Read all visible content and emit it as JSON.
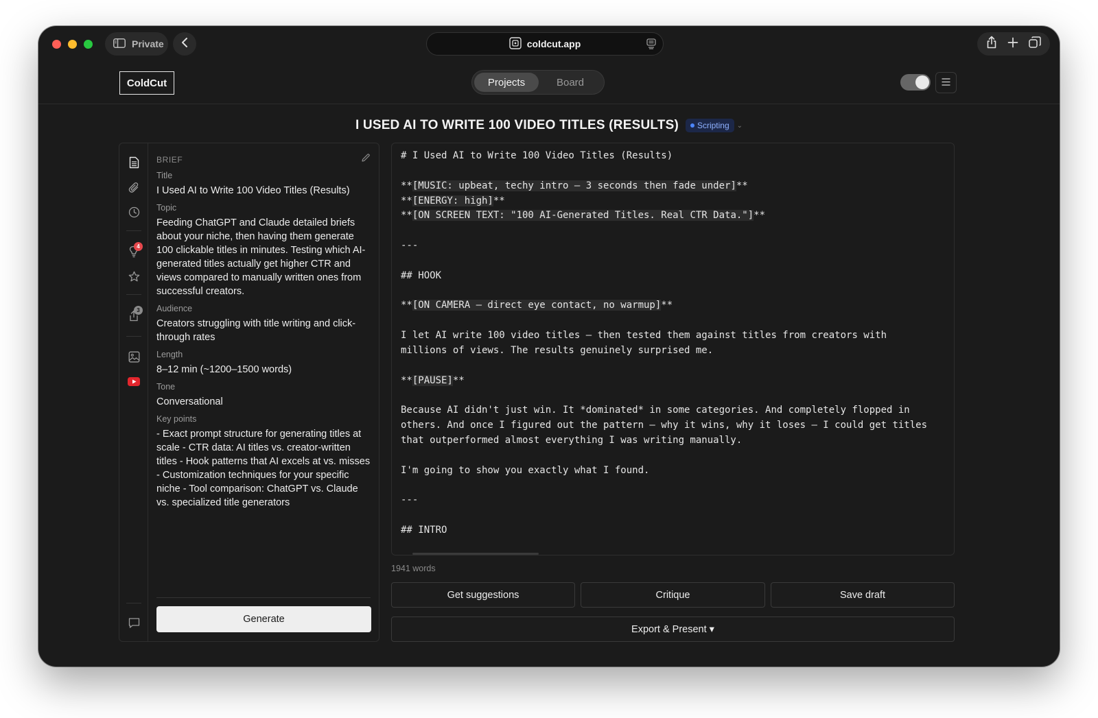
{
  "browser": {
    "private_label": "Private",
    "url": "coldcut.app"
  },
  "app": {
    "logo": "ColdCut",
    "tabs": [
      {
        "label": "Projects",
        "active": true
      },
      {
        "label": "Board",
        "active": false
      }
    ],
    "theme_toggle_on": true
  },
  "project": {
    "title": "I USED AI TO WRITE 100 VIDEO TITLES (RESULTS)",
    "status": "Scripting",
    "status_color": "#4d86ff"
  },
  "sidebar": {
    "icons": [
      {
        "name": "document-icon"
      },
      {
        "name": "paperclip-icon"
      },
      {
        "name": "clock-icon"
      },
      {
        "name": "lightbulb-icon",
        "badge": "4"
      },
      {
        "name": "star-icon"
      },
      {
        "name": "share-icon",
        "badge": "3"
      },
      {
        "name": "image-icon"
      },
      {
        "name": "youtube-icon"
      },
      {
        "name": "chat-icon"
      }
    ]
  },
  "brief": {
    "heading": "BRIEF",
    "fields": {
      "title": {
        "label": "Title",
        "value": "I Used AI to Write 100 Video Titles (Results)"
      },
      "topic": {
        "label": "Topic",
        "value": "Feeding ChatGPT and Claude detailed briefs about your niche, then having them generate 100 clickable titles in minutes. Testing which AI-generated titles actually get higher CTR and views compared to manually written ones from successful creators."
      },
      "audience": {
        "label": "Audience",
        "value": "Creators struggling with title writing and click-through rates"
      },
      "length": {
        "label": "Length",
        "value": "8–12 min (~1200–1500 words)"
      },
      "tone": {
        "label": "Tone",
        "value": "Conversational"
      },
      "key_points": {
        "label": "Key points",
        "value": "- Exact prompt structure for generating titles at scale - CTR data: AI titles vs. creator-written titles - Hook patterns that AI excels at vs. misses - Customization techniques for your specific niche - Tool comparison: ChatGPT vs. Claude vs. specialized title generators"
      }
    },
    "generate_label": "Generate"
  },
  "editor": {
    "lines": [
      {
        "pre": "# I Used AI to Write 100 Video Titles (Results)",
        "hl": "",
        "post": ""
      },
      {
        "pre": "",
        "hl": "",
        "post": ""
      },
      {
        "pre": "**",
        "hl": "[MUSIC: upbeat, techy intro — 3 seconds then fade under]",
        "post": "**"
      },
      {
        "pre": "**",
        "hl": "[ENERGY: high]",
        "post": "**"
      },
      {
        "pre": "**",
        "hl": "[ON SCREEN TEXT: \"100 AI-Generated Titles. Real CTR Data.\"]",
        "post": "**"
      },
      {
        "pre": "",
        "hl": "",
        "post": ""
      },
      {
        "pre": "---",
        "hl": "",
        "post": ""
      },
      {
        "pre": "",
        "hl": "",
        "post": ""
      },
      {
        "pre": "## HOOK",
        "hl": "",
        "post": ""
      },
      {
        "pre": "",
        "hl": "",
        "post": ""
      },
      {
        "pre": "**",
        "hl": "[ON CAMERA — direct eye contact, no warmup]",
        "post": "**"
      },
      {
        "pre": "",
        "hl": "",
        "post": ""
      },
      {
        "pre": "I let AI write 100 video titles — then tested them against titles from creators with",
        "hl": "",
        "post": ""
      },
      {
        "pre": "millions of views. The results genuinely surprised me.",
        "hl": "",
        "post": ""
      },
      {
        "pre": "",
        "hl": "",
        "post": ""
      },
      {
        "pre": "**",
        "hl": "[PAUSE]",
        "post": "**"
      },
      {
        "pre": "",
        "hl": "",
        "post": ""
      },
      {
        "pre": "Because AI didn't just win. It *dominated* in some categories. And completely flopped in",
        "hl": "",
        "post": ""
      },
      {
        "pre": "others. And once I figured out the pattern — why it wins, why it loses — I could get titles",
        "hl": "",
        "post": ""
      },
      {
        "pre": "that outperformed almost everything I was writing manually.",
        "hl": "",
        "post": ""
      },
      {
        "pre": "",
        "hl": "",
        "post": ""
      },
      {
        "pre": "I'm going to show you exactly what I found.",
        "hl": "",
        "post": ""
      },
      {
        "pre": "",
        "hl": "",
        "post": ""
      },
      {
        "pre": "---",
        "hl": "",
        "post": ""
      },
      {
        "pre": "",
        "hl": "",
        "post": ""
      },
      {
        "pre": "## INTRO",
        "hl": "",
        "post": ""
      }
    ],
    "word_count": "1941 words"
  },
  "actions": {
    "suggestions_label": "Get suggestions",
    "critique_label": "Critique",
    "save_label": "Save draft",
    "export_label": "Export & Present ▾"
  }
}
